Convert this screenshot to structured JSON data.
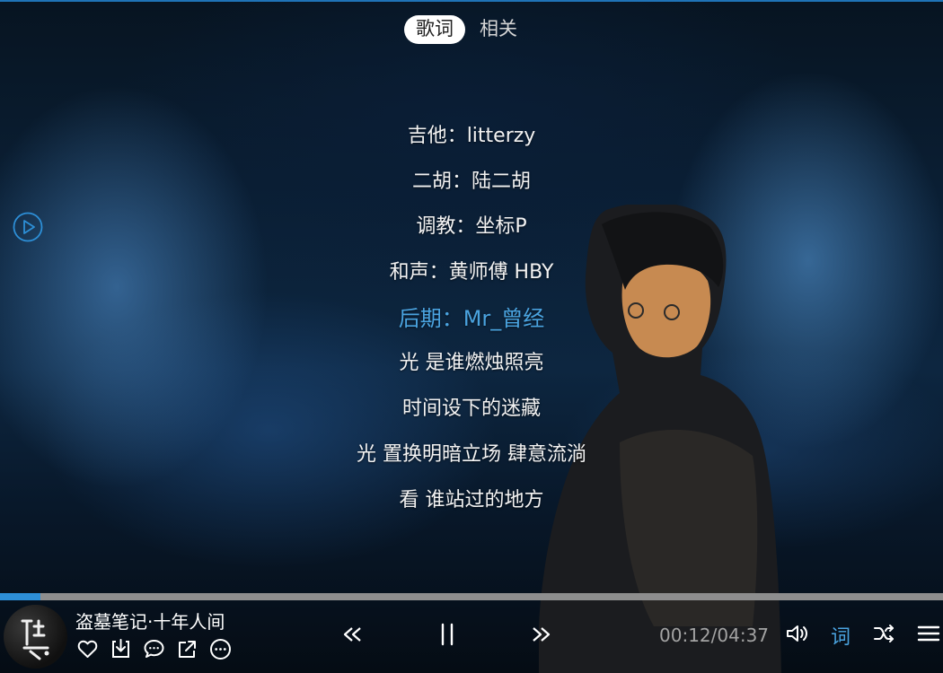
{
  "tabs": {
    "lyrics": "歌词",
    "related": "相关"
  },
  "lyrics": {
    "lines": [
      "吉他：litterzy",
      "二胡：陆二胡",
      "调教：坐标P",
      "和声：黄师傅 HBY",
      "后期：Mr_曾经",
      "光 是谁燃烛照亮",
      "时间设下的迷藏",
      "光 置换明暗立场 肆意流淌",
      "看 谁站过的地方"
    ],
    "current_index": 4
  },
  "player": {
    "song_title": "盗墓笔记·十年人间",
    "elapsed": "00:12",
    "separator": "/",
    "total": "04:37",
    "progress_fraction": 0.043,
    "lyric_toggle_label": "词"
  },
  "icons": {
    "side_play": "play-circle-icon",
    "like": "heart-icon",
    "download": "download-icon",
    "comment": "comment-icon",
    "share": "share-icon",
    "more": "more-icon",
    "previous": "previous-icon",
    "pause": "pause-icon",
    "next": "next-icon",
    "volume": "volume-icon",
    "shuffle": "shuffle-icon",
    "menu": "menu-icon"
  },
  "colors": {
    "accent": "#2d8fd7",
    "active_lyric": "#4aa3df",
    "progress_track": "#8e8e8e"
  }
}
